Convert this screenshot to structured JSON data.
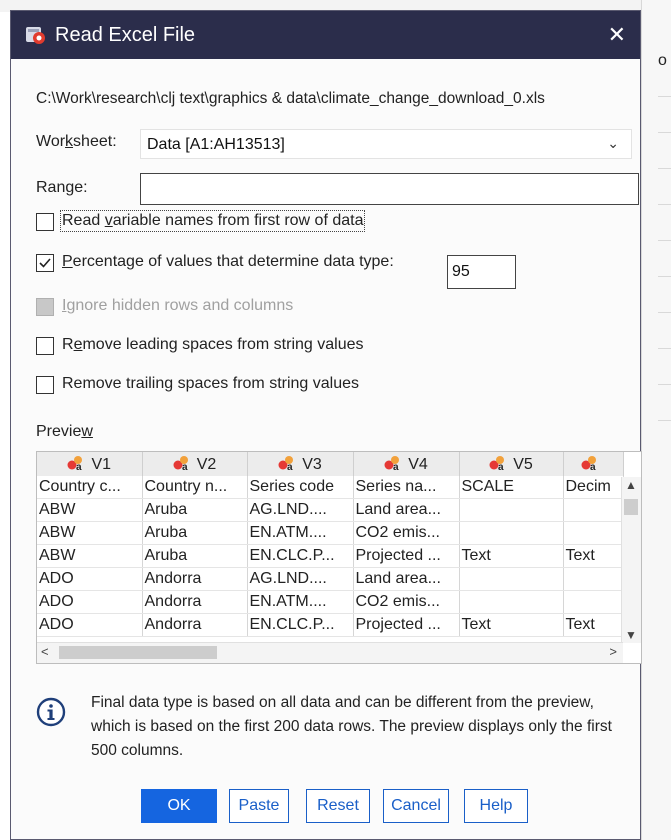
{
  "window": {
    "title": "Read Excel File",
    "close_glyph": "✕"
  },
  "background": {
    "edge_text": "o"
  },
  "file_path": "C:\\Work\\research\\clj text\\graphics & data\\climate_change_download_0.xls",
  "worksheet": {
    "label_pre": "Wor",
    "label_u": "k",
    "label_post": "sheet:",
    "value": "Data [A1:AH13513]",
    "chevron": "⌄"
  },
  "range": {
    "label_pre": "Ran",
    "label_u": "g",
    "label_post": "e:",
    "value": ""
  },
  "options": {
    "read_var_names": {
      "pre": "Read ",
      "u": "v",
      "post": "ariable names from first row of data",
      "checked": false
    },
    "percentage": {
      "pre": "",
      "u": "P",
      "post": "ercentage of values that determine data type:",
      "checked": true,
      "value": "95"
    },
    "ignore_hidden": {
      "pre": "",
      "u": "I",
      "post": "gnore hidden rows and columns",
      "checked": false,
      "disabled": true
    },
    "remove_leading": {
      "pre": "R",
      "u": "e",
      "post": "move leading spaces from string values",
      "checked": false
    },
    "remove_trailing": {
      "pre": "Remove trailing spaces from string values",
      "u": "",
      "post": "",
      "checked": false
    }
  },
  "preview": {
    "label_pre": "Previe",
    "label_u": "w",
    "label_post": "",
    "columns": [
      "V1",
      "V2",
      "V3",
      "V4",
      "V5",
      ""
    ],
    "header_row": [
      "Country c...",
      "Country n...",
      "Series code",
      "Series na...",
      "SCALE",
      "Decim"
    ],
    "rows": [
      [
        "ABW",
        "Aruba",
        "AG.LND....",
        "Land area...",
        "",
        ""
      ],
      [
        "ABW",
        "Aruba",
        "EN.ATM....",
        "CO2 emis...",
        "",
        ""
      ],
      [
        "ABW",
        "Aruba",
        "EN.CLC.P...",
        "Projected ...",
        "Text",
        "Text"
      ],
      [
        "ADO",
        "Andorra",
        "AG.LND....",
        "Land area...",
        "",
        ""
      ],
      [
        "ADO",
        "Andorra",
        "EN.ATM....",
        "CO2 emis...",
        "",
        ""
      ],
      [
        "ADO",
        "Andorra",
        "EN.CLC.P...",
        "Projected ...",
        "Text",
        "Text"
      ]
    ]
  },
  "info_text": "Final data type is based on all data and can be different from the preview, which is based on the first 200 data rows. The preview displays only the first 500 columns.",
  "buttons": {
    "ok": "OK",
    "paste": "Paste",
    "reset": "Reset",
    "cancel": "Cancel",
    "help": "Help"
  },
  "colors": {
    "titlebar": "#2b2d4b",
    "primary": "#1565e0",
    "secondary_text": "#1a5fc8"
  },
  "icons": {
    "app": "spss-app-icon",
    "variable": "nominal-variable-icon",
    "info": "info-circle-icon"
  }
}
